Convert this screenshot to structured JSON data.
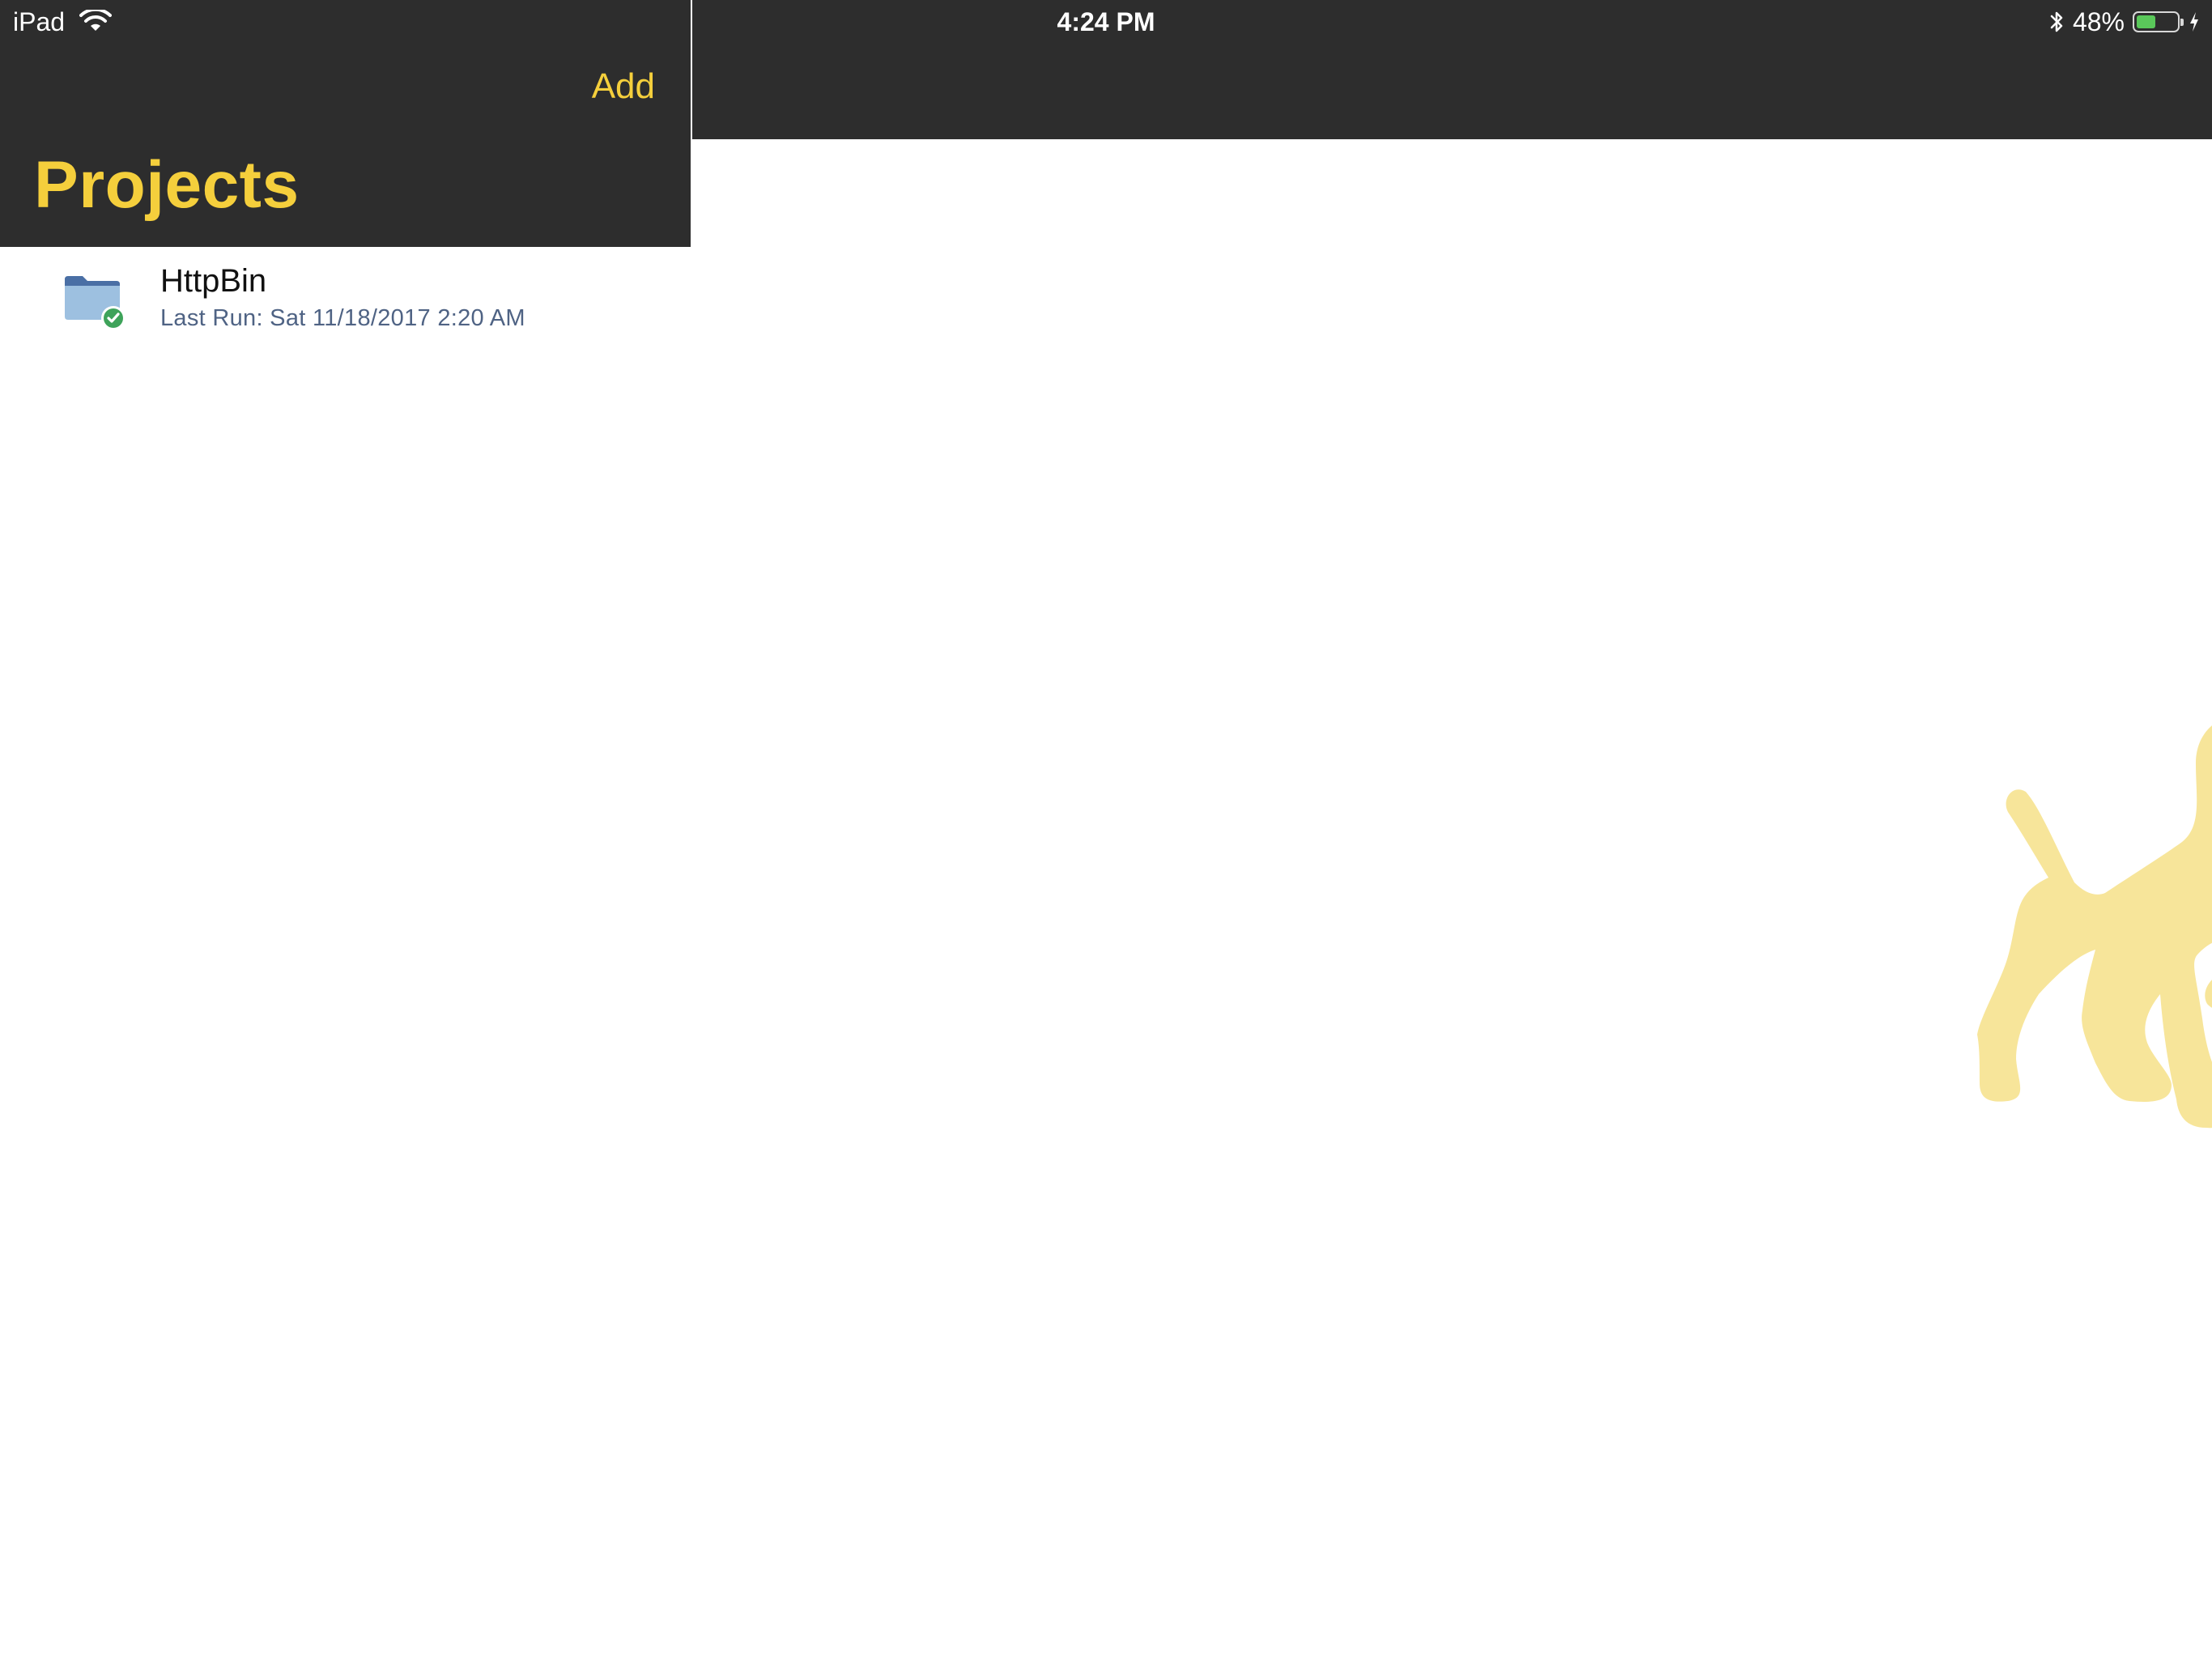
{
  "status_bar": {
    "device": "iPad",
    "time": "4:24 PM",
    "battery_percent_label": "48%",
    "battery_level": 0.48,
    "icons": [
      "wifi-icon",
      "bluetooth-icon",
      "battery-icon",
      "charging-bolt-icon"
    ]
  },
  "master": {
    "add_label": "Add",
    "title": "Projects",
    "projects": [
      {
        "name": "HttpBin",
        "subtitle": "Last Run: Sat 11/18/2017 2:20 AM",
        "icon": "folder-check-icon"
      }
    ]
  },
  "detail": {
    "placeholder_icon": "dog-silhouette-icon"
  },
  "colors": {
    "bar_background": "#2d2d2d",
    "accent_yellow": "#f5cf3c",
    "subtitle_blue": "#4f6384",
    "folder_light": "#9dc0e0",
    "folder_dark": "#4a6fa5",
    "check_green": "#3ea35a",
    "dog_fill": "#f7e59a",
    "battery_green": "#5ac85a"
  }
}
